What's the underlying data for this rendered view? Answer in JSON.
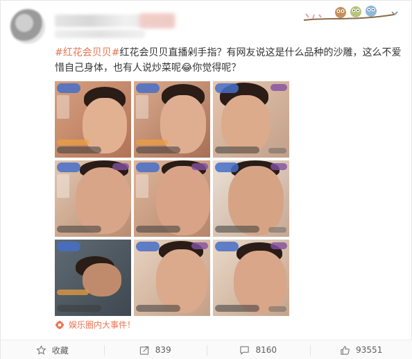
{
  "post": {
    "tag": "#红花会贝贝#",
    "body": "红花会贝贝直播剁手指？有网友说这是什么品种的沙雕，这么不爱惜自己身体，也有人说炒菜呢",
    "emoji": "😂",
    "tail": "你觉得呢？"
  },
  "images": {
    "count": 9
  },
  "source": {
    "label": "娱乐圈内大事件！"
  },
  "actions": {
    "favorite_label": "收藏",
    "repost_count": "839",
    "comment_count": "8160",
    "like_count": "93551"
  },
  "colors": {
    "accent": "#eb7350",
    "text": "#333333",
    "muted": "#5b5b5b"
  },
  "icons": [
    "star-icon",
    "repost-icon",
    "comment-icon",
    "like-icon",
    "chevron-down-icon",
    "flower-icon"
  ]
}
